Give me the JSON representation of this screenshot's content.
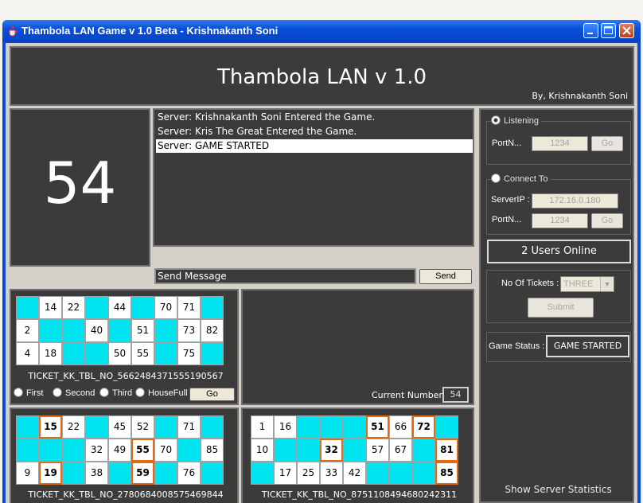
{
  "window": {
    "title": "Thambola LAN Game v 1.0 Beta - Krishnakanth Soni"
  },
  "header": {
    "title": "Thambola LAN v 1.0",
    "byline": "By, Krishnakanth Soni"
  },
  "current_called_number": "54",
  "chat": {
    "messages": [
      "Server: Krishnakanth Soni Entered the Game.",
      "Server: Kris The Great Entered the Game.",
      "Server: GAME STARTED"
    ],
    "selected_index": 2,
    "input_value": "Send Message",
    "send_label": "Send"
  },
  "claim_options": [
    "First",
    "Second",
    "Third",
    "HouseFull"
  ],
  "go_label": "Go",
  "current_number": {
    "label": "Current Number :",
    "value": "54"
  },
  "tickets": [
    {
      "id": "TICKET_KK_TBL_NO_5662484371555190567",
      "rows": [
        [
          "",
          "14",
          "22",
          "",
          "44",
          "",
          "70",
          "71",
          ""
        ],
        [
          "2",
          "",
          "",
          "40",
          "",
          "51",
          "",
          "73",
          "82"
        ],
        [
          "4",
          "18",
          "",
          "",
          "50",
          "55",
          "",
          "75",
          ""
        ]
      ],
      "marked": []
    },
    {
      "id": "TICKET_KK_TBL_NO_2780684008575469844",
      "rows": [
        [
          "",
          "15",
          "22",
          "",
          "45",
          "52",
          "",
          "71",
          ""
        ],
        [
          "",
          "",
          "",
          "32",
          "49",
          "55",
          "70",
          "",
          "85"
        ],
        [
          "9",
          "19",
          "",
          "38",
          "",
          "59",
          "",
          "76",
          ""
        ]
      ],
      "marked": [
        "15",
        "55",
        "19",
        "59"
      ]
    },
    {
      "id": "TICKET_KK_TBL_NO_8751108494680242311",
      "rows": [
        [
          "1",
          "16",
          "",
          "",
          "",
          "51",
          "66",
          "72",
          ""
        ],
        [
          "10",
          "",
          "",
          "32",
          "",
          "57",
          "67",
          "",
          "81"
        ],
        [
          "",
          "17",
          "25",
          "33",
          "42",
          "",
          "",
          "",
          "85"
        ]
      ],
      "marked": [
        "51",
        "72",
        "32",
        "81",
        "85"
      ]
    }
  ],
  "side": {
    "listening": {
      "title": "Listening",
      "selected": true,
      "port_label": "PortN...",
      "port_value": "1234",
      "go_label": "Go"
    },
    "connect": {
      "title": "Connect To",
      "selected": false,
      "ip_label": "ServerIP :",
      "ip_value": "172.16.0.180",
      "port_label": "PortN...",
      "port_value": "1234",
      "go_label": "Go"
    },
    "users_online": "2 Users Online",
    "tickets_label": "No Of Tickets :",
    "tickets_value": "THREE",
    "submit_label": "Submit",
    "game_status_label": "Game Status :",
    "game_status_value": "GAME STARTED",
    "stats_label": "Show Server Statistics"
  },
  "colors": {
    "panel_bg": "#3b3b3b",
    "cell_empty": "#00e4f0",
    "cell_number": "#ffffff",
    "cell_marked_border": "#e46a12",
    "titlebar": "#0a4ed8"
  }
}
